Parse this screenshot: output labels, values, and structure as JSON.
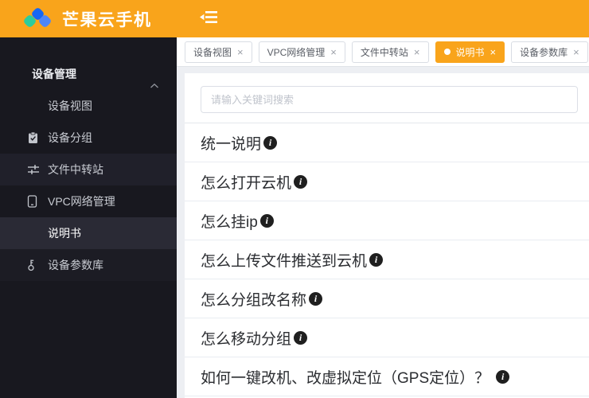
{
  "colors": {
    "accent": "#F9A41B",
    "sidebar_bg": "#18181F",
    "active_row_bg": "#2A2A35",
    "content_bg": "#EDEFF3"
  },
  "header": {
    "app_title": "芒果云手机"
  },
  "sidebar": {
    "group": {
      "label": "设备管理",
      "state": "expanded"
    },
    "items": [
      {
        "label": "设备视图",
        "icon": ""
      },
      {
        "label": "设备分组",
        "icon": "clipboard-check-icon"
      },
      {
        "label": "文件中转站",
        "icon": "sliders-icon"
      },
      {
        "label": "VPC网络管理",
        "icon": "phone-icon"
      },
      {
        "label": "说明书",
        "icon": "",
        "active": true
      },
      {
        "label": "设备参数库",
        "icon": "key-icon"
      }
    ]
  },
  "tabs": {
    "close_glyph": "×",
    "items": [
      {
        "label": "设备视图"
      },
      {
        "label": "VPC网络管理"
      },
      {
        "label": "文件中转站"
      },
      {
        "label": "说明书",
        "active": true
      },
      {
        "label": "设备参数库"
      }
    ]
  },
  "search": {
    "placeholder": "请输入关键词搜索",
    "value": ""
  },
  "faq": {
    "info_glyph": "i",
    "items": [
      {
        "title": "统一说明"
      },
      {
        "title": "怎么打开云机"
      },
      {
        "title": "怎么挂ip"
      },
      {
        "title": "怎么上传文件推送到云机"
      },
      {
        "title": "怎么分组改名称"
      },
      {
        "title": "怎么移动分组"
      },
      {
        "title": "如何一键改机、改虚拟定位（GPS定位）？"
      }
    ]
  }
}
